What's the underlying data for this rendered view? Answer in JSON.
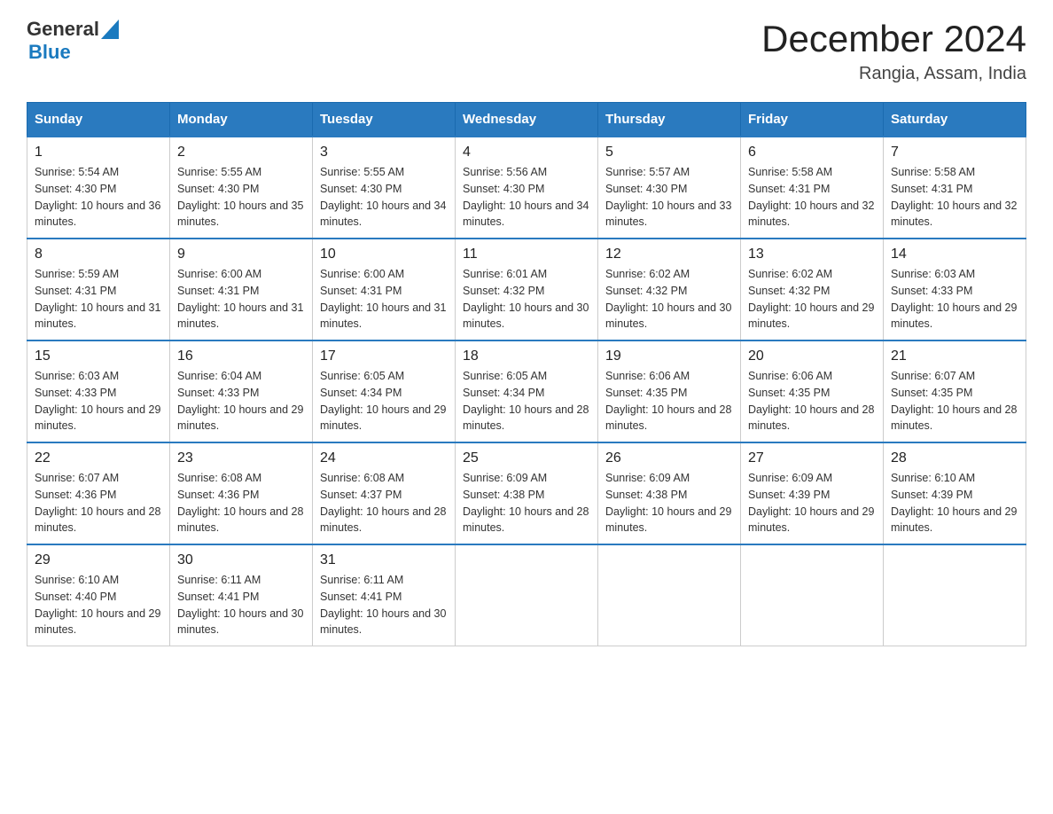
{
  "header": {
    "logo_general": "General",
    "logo_blue": "Blue",
    "month_title": "December 2024",
    "location": "Rangia, Assam, India"
  },
  "days_of_week": [
    "Sunday",
    "Monday",
    "Tuesday",
    "Wednesday",
    "Thursday",
    "Friday",
    "Saturday"
  ],
  "weeks": [
    [
      {
        "day": "1",
        "sunrise": "5:54 AM",
        "sunset": "4:30 PM",
        "daylight": "10 hours and 36 minutes."
      },
      {
        "day": "2",
        "sunrise": "5:55 AM",
        "sunset": "4:30 PM",
        "daylight": "10 hours and 35 minutes."
      },
      {
        "day": "3",
        "sunrise": "5:55 AM",
        "sunset": "4:30 PM",
        "daylight": "10 hours and 34 minutes."
      },
      {
        "day": "4",
        "sunrise": "5:56 AM",
        "sunset": "4:30 PM",
        "daylight": "10 hours and 34 minutes."
      },
      {
        "day": "5",
        "sunrise": "5:57 AM",
        "sunset": "4:30 PM",
        "daylight": "10 hours and 33 minutes."
      },
      {
        "day": "6",
        "sunrise": "5:58 AM",
        "sunset": "4:31 PM",
        "daylight": "10 hours and 32 minutes."
      },
      {
        "day": "7",
        "sunrise": "5:58 AM",
        "sunset": "4:31 PM",
        "daylight": "10 hours and 32 minutes."
      }
    ],
    [
      {
        "day": "8",
        "sunrise": "5:59 AM",
        "sunset": "4:31 PM",
        "daylight": "10 hours and 31 minutes."
      },
      {
        "day": "9",
        "sunrise": "6:00 AM",
        "sunset": "4:31 PM",
        "daylight": "10 hours and 31 minutes."
      },
      {
        "day": "10",
        "sunrise": "6:00 AM",
        "sunset": "4:31 PM",
        "daylight": "10 hours and 31 minutes."
      },
      {
        "day": "11",
        "sunrise": "6:01 AM",
        "sunset": "4:32 PM",
        "daylight": "10 hours and 30 minutes."
      },
      {
        "day": "12",
        "sunrise": "6:02 AM",
        "sunset": "4:32 PM",
        "daylight": "10 hours and 30 minutes."
      },
      {
        "day": "13",
        "sunrise": "6:02 AM",
        "sunset": "4:32 PM",
        "daylight": "10 hours and 29 minutes."
      },
      {
        "day": "14",
        "sunrise": "6:03 AM",
        "sunset": "4:33 PM",
        "daylight": "10 hours and 29 minutes."
      }
    ],
    [
      {
        "day": "15",
        "sunrise": "6:03 AM",
        "sunset": "4:33 PM",
        "daylight": "10 hours and 29 minutes."
      },
      {
        "day": "16",
        "sunrise": "6:04 AM",
        "sunset": "4:33 PM",
        "daylight": "10 hours and 29 minutes."
      },
      {
        "day": "17",
        "sunrise": "6:05 AM",
        "sunset": "4:34 PM",
        "daylight": "10 hours and 29 minutes."
      },
      {
        "day": "18",
        "sunrise": "6:05 AM",
        "sunset": "4:34 PM",
        "daylight": "10 hours and 28 minutes."
      },
      {
        "day": "19",
        "sunrise": "6:06 AM",
        "sunset": "4:35 PM",
        "daylight": "10 hours and 28 minutes."
      },
      {
        "day": "20",
        "sunrise": "6:06 AM",
        "sunset": "4:35 PM",
        "daylight": "10 hours and 28 minutes."
      },
      {
        "day": "21",
        "sunrise": "6:07 AM",
        "sunset": "4:35 PM",
        "daylight": "10 hours and 28 minutes."
      }
    ],
    [
      {
        "day": "22",
        "sunrise": "6:07 AM",
        "sunset": "4:36 PM",
        "daylight": "10 hours and 28 minutes."
      },
      {
        "day": "23",
        "sunrise": "6:08 AM",
        "sunset": "4:36 PM",
        "daylight": "10 hours and 28 minutes."
      },
      {
        "day": "24",
        "sunrise": "6:08 AM",
        "sunset": "4:37 PM",
        "daylight": "10 hours and 28 minutes."
      },
      {
        "day": "25",
        "sunrise": "6:09 AM",
        "sunset": "4:38 PM",
        "daylight": "10 hours and 28 minutes."
      },
      {
        "day": "26",
        "sunrise": "6:09 AM",
        "sunset": "4:38 PM",
        "daylight": "10 hours and 29 minutes."
      },
      {
        "day": "27",
        "sunrise": "6:09 AM",
        "sunset": "4:39 PM",
        "daylight": "10 hours and 29 minutes."
      },
      {
        "day": "28",
        "sunrise": "6:10 AM",
        "sunset": "4:39 PM",
        "daylight": "10 hours and 29 minutes."
      }
    ],
    [
      {
        "day": "29",
        "sunrise": "6:10 AM",
        "sunset": "4:40 PM",
        "daylight": "10 hours and 29 minutes."
      },
      {
        "day": "30",
        "sunrise": "6:11 AM",
        "sunset": "4:41 PM",
        "daylight": "10 hours and 30 minutes."
      },
      {
        "day": "31",
        "sunrise": "6:11 AM",
        "sunset": "4:41 PM",
        "daylight": "10 hours and 30 minutes."
      },
      null,
      null,
      null,
      null
    ]
  ]
}
